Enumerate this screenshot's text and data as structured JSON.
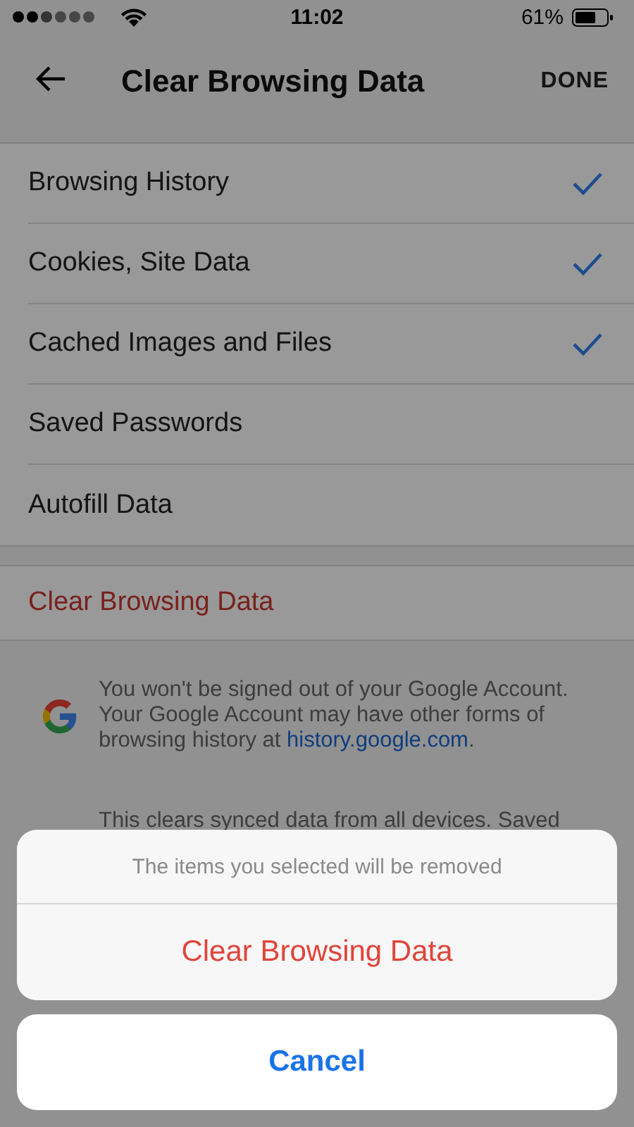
{
  "status_bar": {
    "time": "11:02",
    "battery": "61%"
  },
  "header": {
    "title": "Clear Browsing Data",
    "done": "DONE"
  },
  "data_types": [
    {
      "label": "Browsing History",
      "checked": true
    },
    {
      "label": "Cookies, Site Data",
      "checked": true
    },
    {
      "label": "Cached Images and Files",
      "checked": true
    },
    {
      "label": "Saved Passwords",
      "checked": false
    },
    {
      "label": "Autofill Data",
      "checked": false
    }
  ],
  "clear_button": "Clear Browsing Data",
  "account_note": {
    "text": "You won't be signed out of your Google Account. Your Google Account may have other forms of browsing history at ",
    "link": "history.google.com",
    "after": "."
  },
  "sync_note": "This clears synced data from all devices. Saved",
  "action_sheet": {
    "message": "The items you selected will be removed",
    "destructive": "Clear Browsing Data",
    "cancel": "Cancel"
  }
}
